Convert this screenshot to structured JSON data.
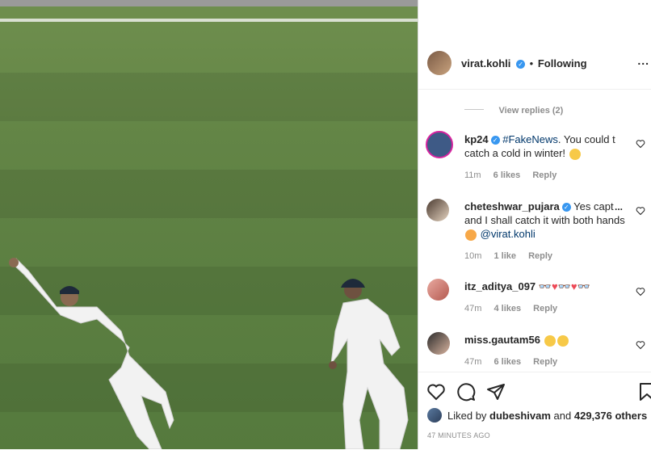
{
  "post": {
    "username": "virat.kohli",
    "separator": "•",
    "follow_status": "Following",
    "more_label": "..."
  },
  "thread": {
    "view_replies": "View replies (2)"
  },
  "comments": [
    {
      "username": "kp24",
      "verified": true,
      "text_parts": [
        "#FakeNews",
        ". You could t catch a cold in winter! "
      ],
      "time": "11m",
      "likes": "6 likes",
      "reply": "Reply"
    },
    {
      "username": "cheteshwar_pujara",
      "verified": true,
      "text_parts": [
        "Yes capt",
        "and I shall catch it with both hands ",
        "@virat.kohli"
      ],
      "more": "...",
      "time": "10m",
      "likes": "1 like",
      "reply": "Reply"
    },
    {
      "username": "itz_aditya_097",
      "verified": false,
      "time": "47m",
      "likes": "4 likes",
      "reply": "Reply"
    },
    {
      "username": "miss.gautam56",
      "verified": false,
      "time": "47m",
      "likes": "6 likes",
      "reply": "Reply"
    }
  ],
  "footer": {
    "liked_by_prefix": "Liked by",
    "liked_by_user": "dubeshivam",
    "liked_by_and": "and",
    "likes_count": "429,376 others",
    "timestamp": "47 MINUTES AGO"
  },
  "colors": {
    "verified": "#3897f0",
    "text": "#262626",
    "muted": "#8e8e8e",
    "link": "#00376b",
    "heart_red": "#ed4956",
    "pitch_green": "#5c7f42"
  }
}
